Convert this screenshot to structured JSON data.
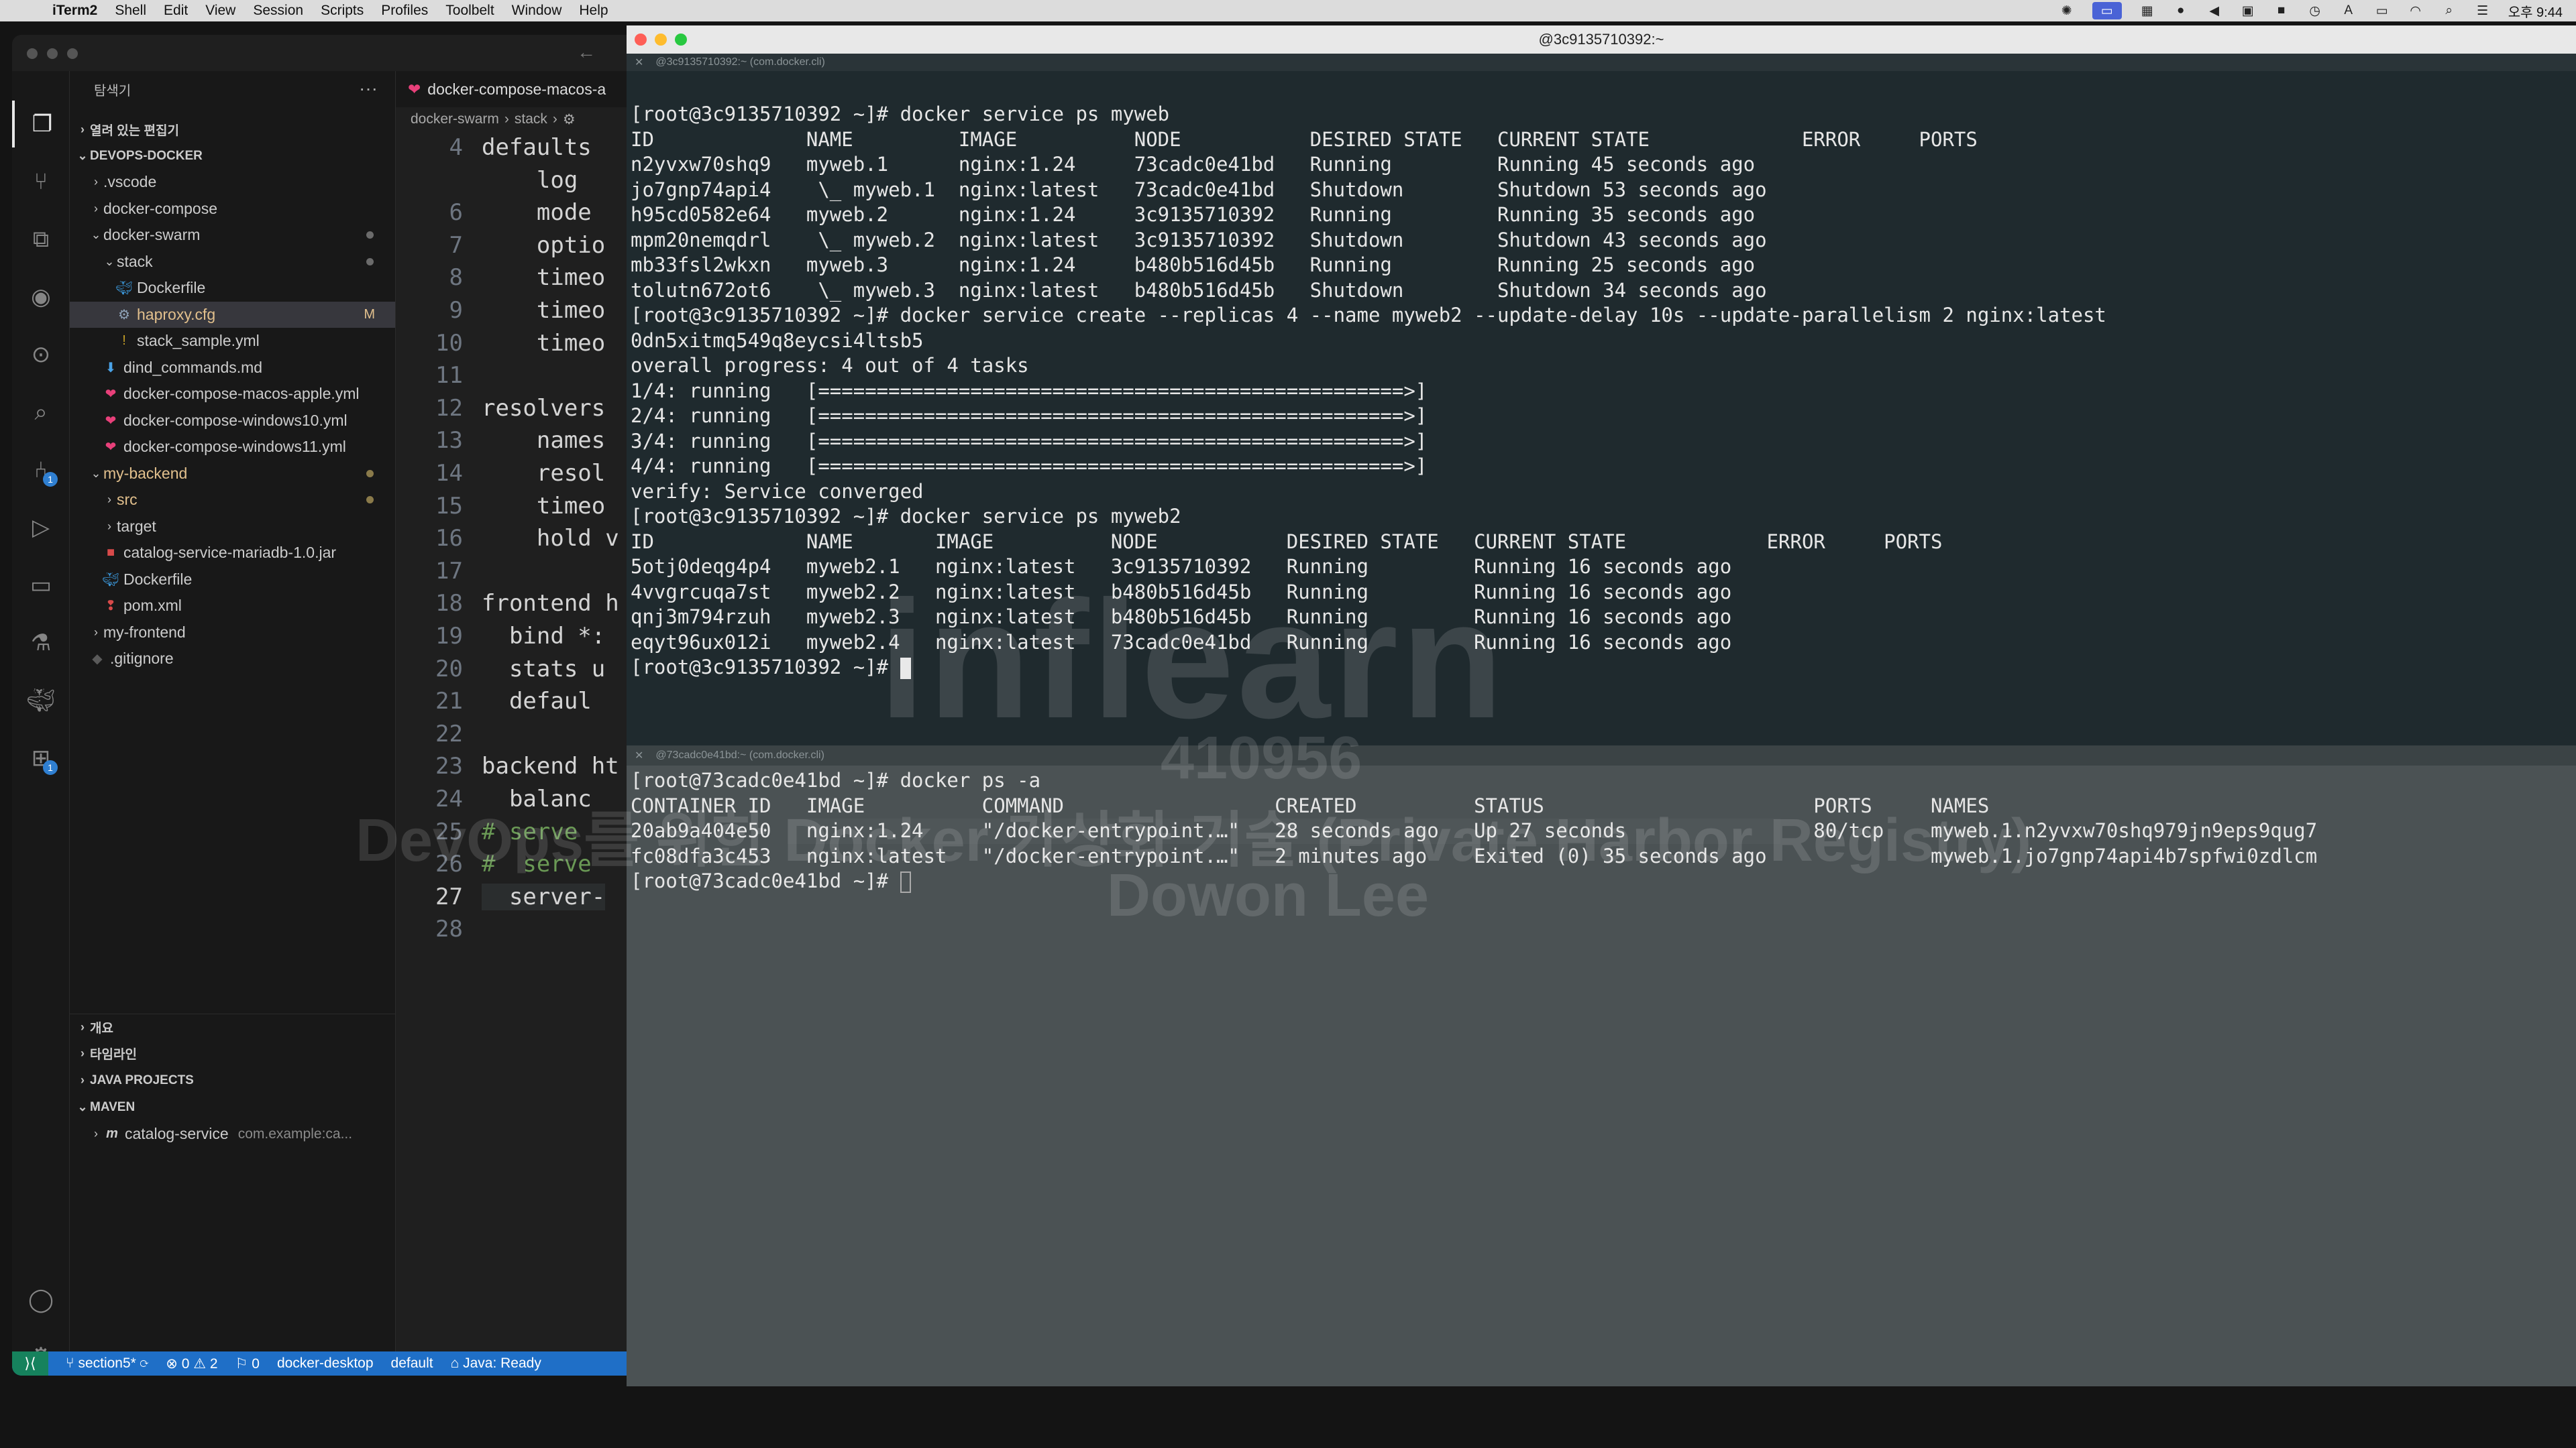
{
  "menubar": {
    "app_name": "iTerm2",
    "items": [
      "Shell",
      "Edit",
      "View",
      "Session",
      "Scripts",
      "Profiles",
      "Toolbelt",
      "Window",
      "Help"
    ],
    "clock": "오후 9:44"
  },
  "vscode": {
    "explorer_title": "탐색기",
    "open_editors": "열려 있는 편집기",
    "workspace": "DEVOPS-DOCKER",
    "tree": [
      {
        "label": ".vscode",
        "kind": "folder",
        "depth": 1,
        "open": false
      },
      {
        "label": "docker-compose",
        "kind": "folder",
        "depth": 1,
        "open": false
      },
      {
        "label": "docker-swarm",
        "kind": "folder",
        "depth": 1,
        "open": true,
        "dot": true
      },
      {
        "label": "stack",
        "kind": "folder",
        "depth": 2,
        "open": true,
        "dot": true
      },
      {
        "label": "Dockerfile",
        "kind": "docker",
        "depth": 3
      },
      {
        "label": "haproxy.cfg",
        "kind": "gear",
        "depth": 3,
        "git": "M",
        "selected": true
      },
      {
        "label": "stack_sample.yml",
        "kind": "yml-excl",
        "depth": 3
      },
      {
        "label": "dind_commands.md",
        "kind": "md",
        "depth": 2
      },
      {
        "label": "docker-compose-macos-apple.yml",
        "kind": "yml",
        "depth": 2
      },
      {
        "label": "docker-compose-windows10.yml",
        "kind": "yml",
        "depth": 2
      },
      {
        "label": "docker-compose-windows11.yml",
        "kind": "yml",
        "depth": 2
      },
      {
        "label": "my-backend",
        "kind": "folder",
        "depth": 1,
        "open": true,
        "dot": true,
        "modified": true
      },
      {
        "label": "src",
        "kind": "folder",
        "depth": 2,
        "open": false,
        "dot": true,
        "modified": true
      },
      {
        "label": "target",
        "kind": "folder",
        "depth": 2,
        "open": false
      },
      {
        "label": "catalog-service-mariadb-1.0.jar",
        "kind": "jar",
        "depth": 2
      },
      {
        "label": "Dockerfile",
        "kind": "docker",
        "depth": 2
      },
      {
        "label": "pom.xml",
        "kind": "xml",
        "depth": 2
      },
      {
        "label": "my-frontend",
        "kind": "folder",
        "depth": 1,
        "open": false
      },
      {
        "label": ".gitignore",
        "kind": "git",
        "depth": 1
      }
    ],
    "sections": [
      "개요",
      "타임라인",
      "JAVA PROJECTS",
      "MAVEN"
    ],
    "maven_item": "catalog-service",
    "maven_item_detail": "com.example:ca...",
    "tab_label": "docker-compose-macos-a",
    "breadcrumb": [
      "docker-swarm",
      "stack"
    ],
    "code_lines": [
      {
        "n": "4",
        "t": "defaults"
      },
      {
        "n": "",
        "t": "    log"
      },
      {
        "n": "6",
        "t": "    mode"
      },
      {
        "n": "7",
        "t": "    optio"
      },
      {
        "n": "8",
        "t": "    timeo"
      },
      {
        "n": "9",
        "t": "    timeo"
      },
      {
        "n": "10",
        "t": "    timeo"
      },
      {
        "n": "11",
        "t": ""
      },
      {
        "n": "12",
        "t": "resolvers"
      },
      {
        "n": "13",
        "t": "    names"
      },
      {
        "n": "14",
        "t": "    resol"
      },
      {
        "n": "15",
        "t": "    timeo"
      },
      {
        "n": "16",
        "t": "    hold v"
      },
      {
        "n": "17",
        "t": ""
      },
      {
        "n": "18",
        "t": "frontend h"
      },
      {
        "n": "19",
        "t": "  bind *:"
      },
      {
        "n": "20",
        "t": "  stats u"
      },
      {
        "n": "21",
        "t": "  defaul"
      },
      {
        "n": "22",
        "t": ""
      },
      {
        "n": "23",
        "t": "backend ht"
      },
      {
        "n": "24",
        "t": "  balanc"
      },
      {
        "n": "25",
        "t": "# serve",
        "comment": true
      },
      {
        "n": "26",
        "t": "#  serve",
        "comment": true
      },
      {
        "n": "27",
        "t": "  server-",
        "current": true
      },
      {
        "n": "28",
        "t": ""
      }
    ],
    "status": {
      "branch": "section5*",
      "errors": "0",
      "warnings": "2",
      "ports": "0",
      "context": "docker-desktop",
      "namespace": "default",
      "java": "Java: Ready"
    }
  },
  "iterm": {
    "title": "@3c9135710392:~",
    "pane1_tab": "@3c9135710392:~ (com.docker.cli)",
    "pane2_tab": "@73cadc0e41bd:~ (com.docker.cli)",
    "pane1_lines": [
      "[root@3c9135710392 ~]# docker service ps myweb",
      "ID             NAME         IMAGE          NODE           DESIRED STATE   CURRENT STATE             ERROR     PORTS",
      "n2yvxw70shq9   myweb.1      nginx:1.24     73cadc0e41bd   Running         Running 45 seconds ago",
      "jo7gnp74api4    \\_ myweb.1  nginx:latest   73cadc0e41bd   Shutdown        Shutdown 53 seconds ago",
      "h95cd0582e64   myweb.2      nginx:1.24     3c9135710392   Running         Running 35 seconds ago",
      "mpm20nemqdrl    \\_ myweb.2  nginx:latest   3c9135710392   Shutdown        Shutdown 43 seconds ago",
      "mb33fsl2wkxn   myweb.3      nginx:1.24     b480b516d45b   Running         Running 25 seconds ago",
      "tolutn672ot6    \\_ myweb.3  nginx:latest   b480b516d45b   Shutdown        Shutdown 34 seconds ago",
      "[root@3c9135710392 ~]# docker service create --replicas 4 --name myweb2 --update-delay 10s --update-parallelism 2 nginx:latest",
      "0dn5xitmq549q8eycsi4ltsb5",
      "overall progress: 4 out of 4 tasks",
      "1/4: running   [==================================================>]",
      "2/4: running   [==================================================>]",
      "3/4: running   [==================================================>]",
      "4/4: running   [==================================================>]",
      "verify: Service converged",
      "[root@3c9135710392 ~]# docker service ps myweb2",
      "ID             NAME       IMAGE          NODE           DESIRED STATE   CURRENT STATE            ERROR     PORTS",
      "5otj0deqg4p4   myweb2.1   nginx:latest   3c9135710392   Running         Running 16 seconds ago",
      "4vvgrcuqa7st   myweb2.2   nginx:latest   b480b516d45b   Running         Running 16 seconds ago",
      "qnj3m794rzuh   myweb2.3   nginx:latest   b480b516d45b   Running         Running 16 seconds ago",
      "eqyt96ux012i   myweb2.4   nginx:latest   73cadc0e41bd   Running         Running 16 seconds ago"
    ],
    "pane1_prompt": "[root@3c9135710392 ~]# ",
    "pane2_lines": [
      "[root@73cadc0e41bd ~]# docker ps -a",
      "CONTAINER ID   IMAGE          COMMAND                  CREATED          STATUS                       PORTS     NAMES",
      "20ab9a404e50   nginx:1.24     \"/docker-entrypoint.…\"   28 seconds ago   Up 27 seconds                80/tcp    myweb.1.n2yvxw70shq979jn9eps9qug7",
      "fc08dfa3c453   nginx:latest   \"/docker-entrypoint.…\"   2 minutes ago    Exited (0) 35 seconds ago              myweb.1.jo7gnp74api4b7spfwi0zdlcm"
    ],
    "pane2_prompt": "[root@73cadc0e41bd ~]# "
  },
  "watermark": {
    "brand": "inflearn",
    "id": "410956",
    "course": "DevOps를 위한 Docker 가상화 기술 (Private Harbor Registry)",
    "author": "Dowon Lee"
  },
  "colors": {
    "vscode_status": "#1f6fc7",
    "terminal_bg": "#1f2a2e",
    "terminal_bg_lower": "#4b5254",
    "modified_git": "#e2c08d",
    "yml_icon": "#e8407a",
    "docker_icon": "#3c99dc"
  }
}
